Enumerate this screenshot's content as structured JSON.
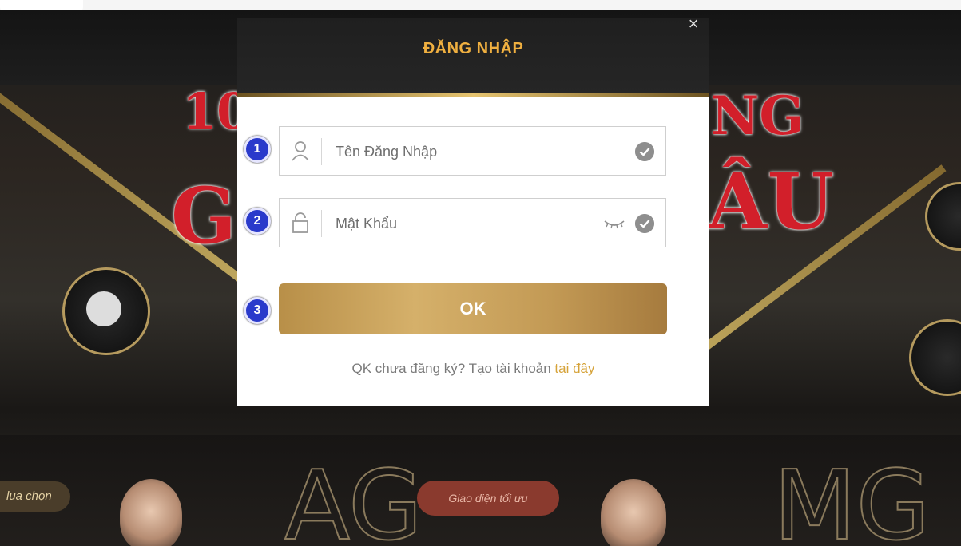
{
  "background": {
    "headline_fragments": [
      "10",
      "NG",
      "G",
      "ÂU"
    ],
    "left_pill": "lua chọn",
    "mid_pill": "Giao diện tối ưu",
    "big_letters_left": "AG",
    "big_letters_right": "MG"
  },
  "modal": {
    "title": "ĐĂNG NHẬP",
    "close_symbol": "×",
    "steps": [
      "1",
      "2",
      "3"
    ],
    "username": {
      "placeholder": "Tên Đăng Nhập",
      "value": "",
      "icon": "user-icon"
    },
    "password": {
      "placeholder": "Mật Khẩu",
      "value": "",
      "icon": "lock-icon"
    },
    "ok_label": "OK",
    "register_prompt": "QK chưa đăng ký? Tạo tài khoản ",
    "register_link": "tại đây"
  },
  "colors": {
    "title": "#f0b040",
    "step_badge": "#2a3acb",
    "button": "#c39a55",
    "link": "#d6a33a"
  }
}
